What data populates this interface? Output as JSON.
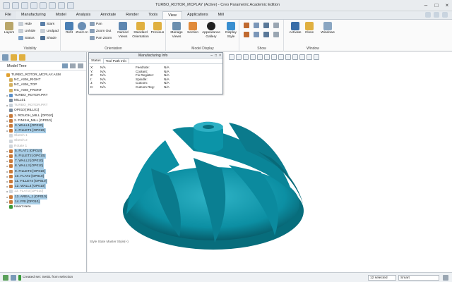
{
  "window": {
    "title": "TURBO_ROTOR_MCPLAY (Active) - Creo Parametric Academic Edition"
  },
  "tabs": [
    "Manufacturing",
    "Model",
    "Analysis",
    "Annotate",
    "Render",
    "Tools",
    "View",
    "Applications",
    "Mill"
  ],
  "file_tab": "File",
  "ribbon": {
    "visibility": {
      "label": "Visibility",
      "layers": "Layers",
      "hide": "Hide",
      "unhide": "Unhide",
      "status": "Status"
    },
    "appearance": {
      "stars": "Stars",
      "undpad": "Undpad",
      "shade": "Shade"
    },
    "orientation": {
      "label": "Orientation",
      "refit": "Refit",
      "zoom_in": "Zoom In",
      "pan": "Pan",
      "zoom_out": "Zoom Out",
      "pan_zoom": "Pan Zoom",
      "named_views": "Named Views",
      "standard_orientation": "Standard Orientation",
      "previous": "Previous"
    },
    "model_display": {
      "label": "Model Display",
      "manage_views": "Manage Views",
      "section": "Section",
      "appearance_gallery": "Appearance Gallery",
      "display_style": "Display Style"
    },
    "show": {
      "label": "Show"
    },
    "window": {
      "label": "Window",
      "activate": "Activate",
      "close": "Close",
      "windows": "Windows"
    }
  },
  "model_tree": {
    "header": "Model Tree",
    "rows": [
      {
        "label": "TURBO_ROTOR_MCPLAY.ASM",
        "indent": 0,
        "sel": false,
        "dim": false,
        "arrow": "",
        "color": "#e0a030"
      },
      {
        "label": "NC_ASM_RIGHT",
        "indent": 1,
        "sel": false,
        "dim": false,
        "arrow": "",
        "color": "#d4b060"
      },
      {
        "label": "NC_ASM_TOP",
        "indent": 1,
        "sel": false,
        "dim": false,
        "arrow": "",
        "color": "#d4b060"
      },
      {
        "label": "NC_ASM_FRONT",
        "indent": 1,
        "sel": false,
        "dim": false,
        "arrow": "",
        "color": "#d4b060"
      },
      {
        "label": "TURBO_ROTOR.PRT",
        "indent": 1,
        "sel": false,
        "dim": false,
        "arrow": "▸",
        "color": "#5a8fc8"
      },
      {
        "label": "MILL01",
        "indent": 1,
        "sel": false,
        "dim": false,
        "arrow": "",
        "color": "#7a8da0"
      },
      {
        "label": "TURBO_ROTOR.PRT",
        "indent": 1,
        "sel": false,
        "dim": true,
        "arrow": "▸",
        "color": "#c8d0d8"
      },
      {
        "label": "OP010 [MILL01]",
        "indent": 1,
        "sel": false,
        "dim": false,
        "arrow": "",
        "color": "#7a8da0"
      },
      {
        "label": "1. ROUGH_MILL [OP010]",
        "indent": 1,
        "sel": false,
        "dim": false,
        "arrow": "▸",
        "color": "#c87a3a"
      },
      {
        "label": "2. FINISH_MILL [OP010]",
        "indent": 1,
        "sel": false,
        "dim": false,
        "arrow": "▸",
        "color": "#c87a3a"
      },
      {
        "label": "3. WALL1 [OP010]",
        "indent": 1,
        "sel": true,
        "dim": false,
        "arrow": "▸",
        "color": "#c87a3a"
      },
      {
        "label": "4. FILLET1 [OP010]",
        "indent": 1,
        "sel": true,
        "dim": false,
        "arrow": "▸",
        "color": "#c87a3a"
      },
      {
        "label": "Sketch 1",
        "indent": 1,
        "sel": false,
        "dim": true,
        "arrow": "",
        "color": "#d0d6dc"
      },
      {
        "label": "Sketch 2",
        "indent": 1,
        "sel": false,
        "dim": true,
        "arrow": "",
        "color": "#d0d6dc"
      },
      {
        "label": "Rotate 1",
        "indent": 1,
        "sel": false,
        "dim": true,
        "arrow": "",
        "color": "#d0d6dc"
      },
      {
        "label": "5. FLAT1 [OP010]",
        "indent": 1,
        "sel": true,
        "dim": false,
        "arrow": "▸",
        "color": "#c87a3a"
      },
      {
        "label": "6. FILLET2 [OP010]",
        "indent": 1,
        "sel": true,
        "dim": false,
        "arrow": "▸",
        "color": "#c87a3a"
      },
      {
        "label": "7. WALL2 [OP010]",
        "indent": 1,
        "sel": true,
        "dim": false,
        "arrow": "▸",
        "color": "#c87a3a"
      },
      {
        "label": "8. WALL3 [OP010]",
        "indent": 1,
        "sel": true,
        "dim": false,
        "arrow": "▸",
        "color": "#c87a3a"
      },
      {
        "label": "9. FILLET3 [OP010]",
        "indent": 1,
        "sel": true,
        "dim": false,
        "arrow": "▸",
        "color": "#c87a3a"
      },
      {
        "label": "10. FLAT2 [OP010]",
        "indent": 1,
        "sel": true,
        "dim": false,
        "arrow": "▸",
        "color": "#c87a3a"
      },
      {
        "label": "11. FILLET4 [OP010]",
        "indent": 1,
        "sel": true,
        "dim": false,
        "arrow": "▸",
        "color": "#c87a3a"
      },
      {
        "label": "12. WALL4 [OP010]",
        "indent": 1,
        "sel": true,
        "dim": false,
        "arrow": "▸",
        "color": "#c87a3a"
      },
      {
        "label": "13. FLAT3 [OP010]",
        "indent": 1,
        "sel": false,
        "dim": true,
        "arrow": "▸",
        "color": "#d0d6dc"
      },
      {
        "label": "13. AREA_1 [OP010]",
        "indent": 1,
        "sel": true,
        "dim": false,
        "arrow": "▸",
        "color": "#c87a3a"
      },
      {
        "label": "14. FRI [OP010]",
        "indent": 1,
        "sel": true,
        "dim": false,
        "arrow": "▸",
        "color": "#c87a3a"
      },
      {
        "label": "Insert Here",
        "indent": 1,
        "sel": false,
        "dim": false,
        "arrow": "",
        "color": "#3a9a3a"
      }
    ]
  },
  "mfg_dialog": {
    "title": "Manufacturing Info",
    "tabs": [
      "Status",
      "Tool Path Info"
    ],
    "rows": [
      [
        "X:",
        "N/A",
        "Feedrate:",
        "N/A"
      ],
      [
        "Y:",
        "N/A",
        "Coolant:",
        "N/A"
      ],
      [
        "Z:",
        "N/A",
        "Fix Register:",
        "N/A"
      ],
      [
        "I:",
        "N/A",
        "Spindle:",
        "N/A"
      ],
      [
        "J:",
        "N/A",
        "Cutcom:",
        "N/A"
      ],
      [
        "K:",
        "N/A",
        "Cutcom Reg:",
        "N/A"
      ]
    ]
  },
  "viewport": {
    "state_text": "Style State Master Style(+)"
  },
  "status_bar": {
    "message": "Created set: Set01 from selection",
    "selected_count": "12 selected",
    "filter": "Smart"
  },
  "colors": {
    "part_teal": "#0c8fa3",
    "part_dark": "#075d6b",
    "selection_blue": "#a9cfe8"
  }
}
